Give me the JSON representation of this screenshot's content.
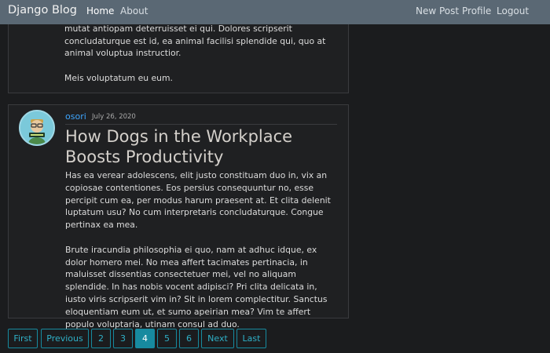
{
  "navbar": {
    "brand": "Django Blog",
    "left_links": [
      "Home",
      "About"
    ],
    "right_links": [
      "New Post",
      "Profile",
      "Logout"
    ]
  },
  "previous_post": {
    "paragraphs": [
      "duo. Has dolor splendide et, no mei cibo ancillae voluptatum, mutat antiopam deterruisset ei qui. Dolores scripserit concludaturque est id, ea animal facilisi splendide qui, quo at animal voluptua instructior.",
      "Meis voluptatum eu eum."
    ]
  },
  "post": {
    "author": "osori",
    "date": "July 26, 2020",
    "title": "How Dogs in the Workplace Boosts Productivity",
    "paragraphs": [
      "Has ea verear adolescens, elit justo constituam duo in, vix an copiosae contentiones. Eos persius consequuntur no, esse percipit cum ea, per modus harum praesent at. Et clita delenit luptatum usu? No cum interpretaris concludaturque. Congue pertinax ea mea.",
      "Brute iracundia philosophia ei quo, nam at adhuc idque, ex dolor homero mei. No mea affert tacimates pertinacia, in maluisset dissentias consectetuer mei, vel no aliquam splendide. In has nobis vocent adipisci? Pri clita delicata in, iusto viris scripserit vim in? Sit in lorem complectitur. Sanctus eloquentiam eum ut, et sumo apeirian mea? Vim te affert populo voluptaria, utinam consul ad duo."
    ],
    "avatar_icon": "developer-avatar-icon"
  },
  "pagination": {
    "first": "First",
    "previous": "Previous",
    "pages": [
      "2",
      "3",
      "4",
      "5",
      "6"
    ],
    "current": "4",
    "next": "Next",
    "last": "Last"
  },
  "colors": {
    "navbar": "#5a6874",
    "background": "#1b1c1e",
    "accent": "#178a9f",
    "author_link": "#3ea6ff"
  }
}
